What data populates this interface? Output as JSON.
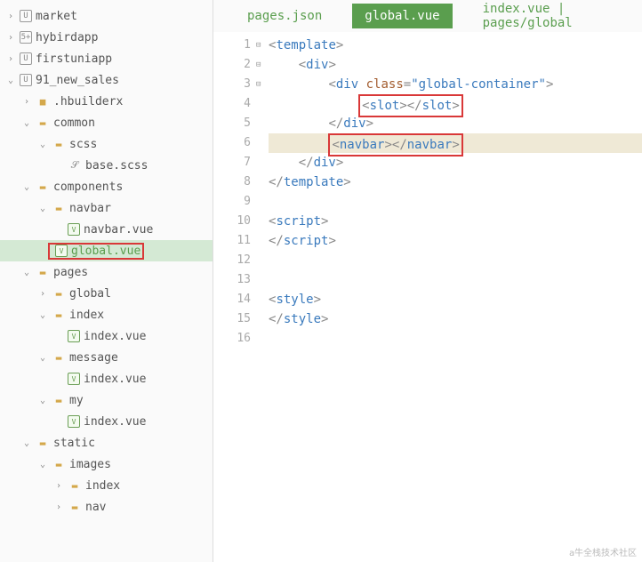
{
  "sidebar": {
    "items": [
      {
        "indent": 0,
        "chev": "›",
        "icon": "project",
        "iconText": "U",
        "label": "market"
      },
      {
        "indent": 0,
        "chev": "›",
        "icon": "project",
        "iconText": "5+",
        "label": "hybirdapp"
      },
      {
        "indent": 0,
        "chev": "›",
        "icon": "project",
        "iconText": "U",
        "label": "firstuniapp"
      },
      {
        "indent": 0,
        "chev": "⌄",
        "icon": "project",
        "iconText": "U",
        "label": "91_new_sales"
      },
      {
        "indent": 1,
        "chev": "›",
        "icon": "folder",
        "iconText": "■",
        "label": ".hbuilderx"
      },
      {
        "indent": 1,
        "chev": "⌄",
        "icon": "folder-open",
        "iconText": "▬",
        "label": "common"
      },
      {
        "indent": 2,
        "chev": "⌄",
        "icon": "folder-open",
        "iconText": "▬",
        "label": "scss"
      },
      {
        "indent": 3,
        "chev": "",
        "icon": "file",
        "iconText": "𝒮",
        "label": "base.scss"
      },
      {
        "indent": 1,
        "chev": "⌄",
        "icon": "folder-open",
        "iconText": "▬",
        "label": "components"
      },
      {
        "indent": 2,
        "chev": "⌄",
        "icon": "folder-open",
        "iconText": "▬",
        "label": "navbar"
      },
      {
        "indent": 3,
        "chev": "",
        "icon": "vue",
        "iconText": "V",
        "label": "navbar.vue"
      },
      {
        "indent": 2,
        "chev": "",
        "icon": "vue",
        "iconText": "V",
        "label": "global.vue",
        "selected": true,
        "boxed": true
      },
      {
        "indent": 1,
        "chev": "⌄",
        "icon": "folder-open",
        "iconText": "▬",
        "label": "pages"
      },
      {
        "indent": 2,
        "chev": "›",
        "icon": "folder-open",
        "iconText": "▬",
        "label": "global"
      },
      {
        "indent": 2,
        "chev": "⌄",
        "icon": "folder-open",
        "iconText": "▬",
        "label": "index"
      },
      {
        "indent": 3,
        "chev": "",
        "icon": "vue",
        "iconText": "V",
        "label": "index.vue"
      },
      {
        "indent": 2,
        "chev": "⌄",
        "icon": "folder-open",
        "iconText": "▬",
        "label": "message"
      },
      {
        "indent": 3,
        "chev": "",
        "icon": "vue",
        "iconText": "V",
        "label": "index.vue"
      },
      {
        "indent": 2,
        "chev": "⌄",
        "icon": "folder-open",
        "iconText": "▬",
        "label": "my"
      },
      {
        "indent": 3,
        "chev": "",
        "icon": "vue",
        "iconText": "V",
        "label": "index.vue"
      },
      {
        "indent": 1,
        "chev": "⌄",
        "icon": "folder-open",
        "iconText": "▬",
        "label": "static"
      },
      {
        "indent": 2,
        "chev": "⌄",
        "icon": "folder-open",
        "iconText": "▬",
        "label": "images"
      },
      {
        "indent": 3,
        "chev": "›",
        "icon": "folder-open",
        "iconText": "▬",
        "label": "index"
      },
      {
        "indent": 3,
        "chev": "›",
        "icon": "folder-open",
        "iconText": "▬",
        "label": "nav"
      }
    ]
  },
  "tabs": [
    {
      "label": "pages.json",
      "active": false
    },
    {
      "label": "global.vue",
      "active": true
    },
    {
      "label": "index.vue | pages/global",
      "active": false
    }
  ],
  "gutter": [
    "1",
    "2",
    "3",
    "4",
    "5",
    "6",
    "7",
    "8",
    "9",
    "10",
    "11",
    "12",
    "13",
    "14",
    "15",
    "16"
  ],
  "fold": [
    "⊟",
    "⊟",
    "⊟",
    "",
    "",
    "",
    "",
    "",
    "",
    "",
    "",
    "",
    "",
    "",
    "",
    ""
  ],
  "code": {
    "l1": {
      "open": "<",
      "tag": "template",
      "close": ">"
    },
    "l2": {
      "indent": "    ",
      "open": "<",
      "tag": "div",
      "close": ">"
    },
    "l3": {
      "indent": "        ",
      "open": "<",
      "tag": "div",
      "sp": " ",
      "attr": "class",
      "eq": "=",
      "q1": "\"",
      "val": "global-container",
      "q2": "\"",
      "close": ">"
    },
    "l4": {
      "indent": "            ",
      "open1": "<",
      "tag1": "slot",
      "close1": ">",
      "open2": "</",
      "tag2": "slot",
      "close2": ">"
    },
    "l5": {
      "indent": "        ",
      "open": "</",
      "tag": "div",
      "close": ">"
    },
    "l6": {
      "indent": "        ",
      "open1": "<",
      "tag1": "navbar",
      "close1": ">",
      "open2": "</",
      "tag2": "navbar",
      "close2": ">"
    },
    "l7": {
      "indent": "    ",
      "open": "</",
      "tag": "div",
      "close": ">"
    },
    "l8": {
      "open": "</",
      "tag": "template",
      "close": ">"
    },
    "l10": {
      "open": "<",
      "tag": "script",
      "close": ">"
    },
    "l11": {
      "open": "</",
      "tag": "script",
      "close": ">"
    },
    "l14": {
      "open": "<",
      "tag": "style",
      "close": ">"
    },
    "l15": {
      "open": "</",
      "tag": "style",
      "close": ">"
    }
  },
  "footer": "a牛全栈技术社区"
}
